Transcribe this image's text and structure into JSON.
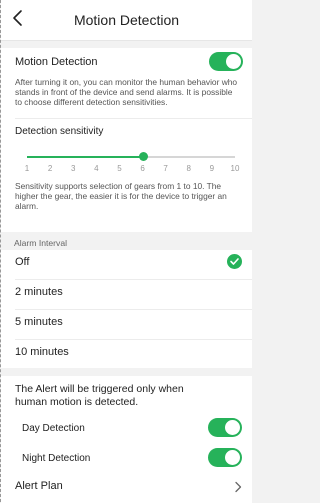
{
  "header": {
    "title": "Motion Detection"
  },
  "motion": {
    "label": "Motion Detection",
    "enabled": true,
    "description": "After turning it on, you can monitor the human behavior who stands in front of the device and send alarms. It is possible to choose different detection sensitivities."
  },
  "sensitivity": {
    "label": "Detection sensitivity",
    "ticks": [
      "1",
      "2",
      "3",
      "4",
      "5",
      "6",
      "7",
      "8",
      "9",
      "10"
    ],
    "value": 6,
    "description": "Sensitivity supports selection of gears from 1 to 10. The higher the gear, the easier it is for the device to trigger an alarm."
  },
  "alarm_interval": {
    "label": "Alarm Interval",
    "options": [
      "Off",
      "2 minutes",
      "5 minutes",
      "10 minutes"
    ],
    "selected": "Off"
  },
  "alert": {
    "note": "The Alert will be triggered only when human motion is detected.",
    "day_label": "Day Detection",
    "day_enabled": true,
    "night_label": "Night Detection",
    "night_enabled": true,
    "plan_label": "Alert Plan"
  },
  "colors": {
    "accent": "#26b25a"
  }
}
